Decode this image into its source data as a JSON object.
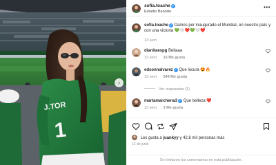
{
  "post": {
    "username": "sofia.toache",
    "location": "Estadio Banorte",
    "verified_mark": "✓",
    "more_icon": "more-horizontal-icon"
  },
  "caption": {
    "username": "sofia.toache",
    "text": "Damos por inaugurado el Mundial, en nuestro país y con una victoria",
    "emoji": "💚🤍❤️💚🤍❤️",
    "time": "13 sem"
  },
  "comments": [
    {
      "username": "dianitaespg",
      "verified": false,
      "text": "Bellaaa",
      "time": "13 sem",
      "likes": "15 Me gusta"
    },
    {
      "username": "edsonnalvarez",
      "verified": true,
      "text": "Que locura 😍🔥",
      "time": "13 sem",
      "likes": "544 Me gusta",
      "replies": "Ver respuestas (1)"
    },
    {
      "username": "martamarchena3",
      "verified": true,
      "text": "Que belleza ❤️",
      "time": "13 sem",
      "likes": "3 Me gusta"
    }
  ],
  "actions": {
    "likes_prefix": "Les gusta a",
    "likes_user": "juankyy",
    "likes_suffix": "y 42,8 mil personas más",
    "date": "12 de junio"
  },
  "footer": {
    "comments_off": "Se limitaron los comentarios en esta publicación."
  },
  "colors": {
    "verified": "#3897f0",
    "heart_red": "#ed4956",
    "jersey_green": "#1f7a3e"
  }
}
